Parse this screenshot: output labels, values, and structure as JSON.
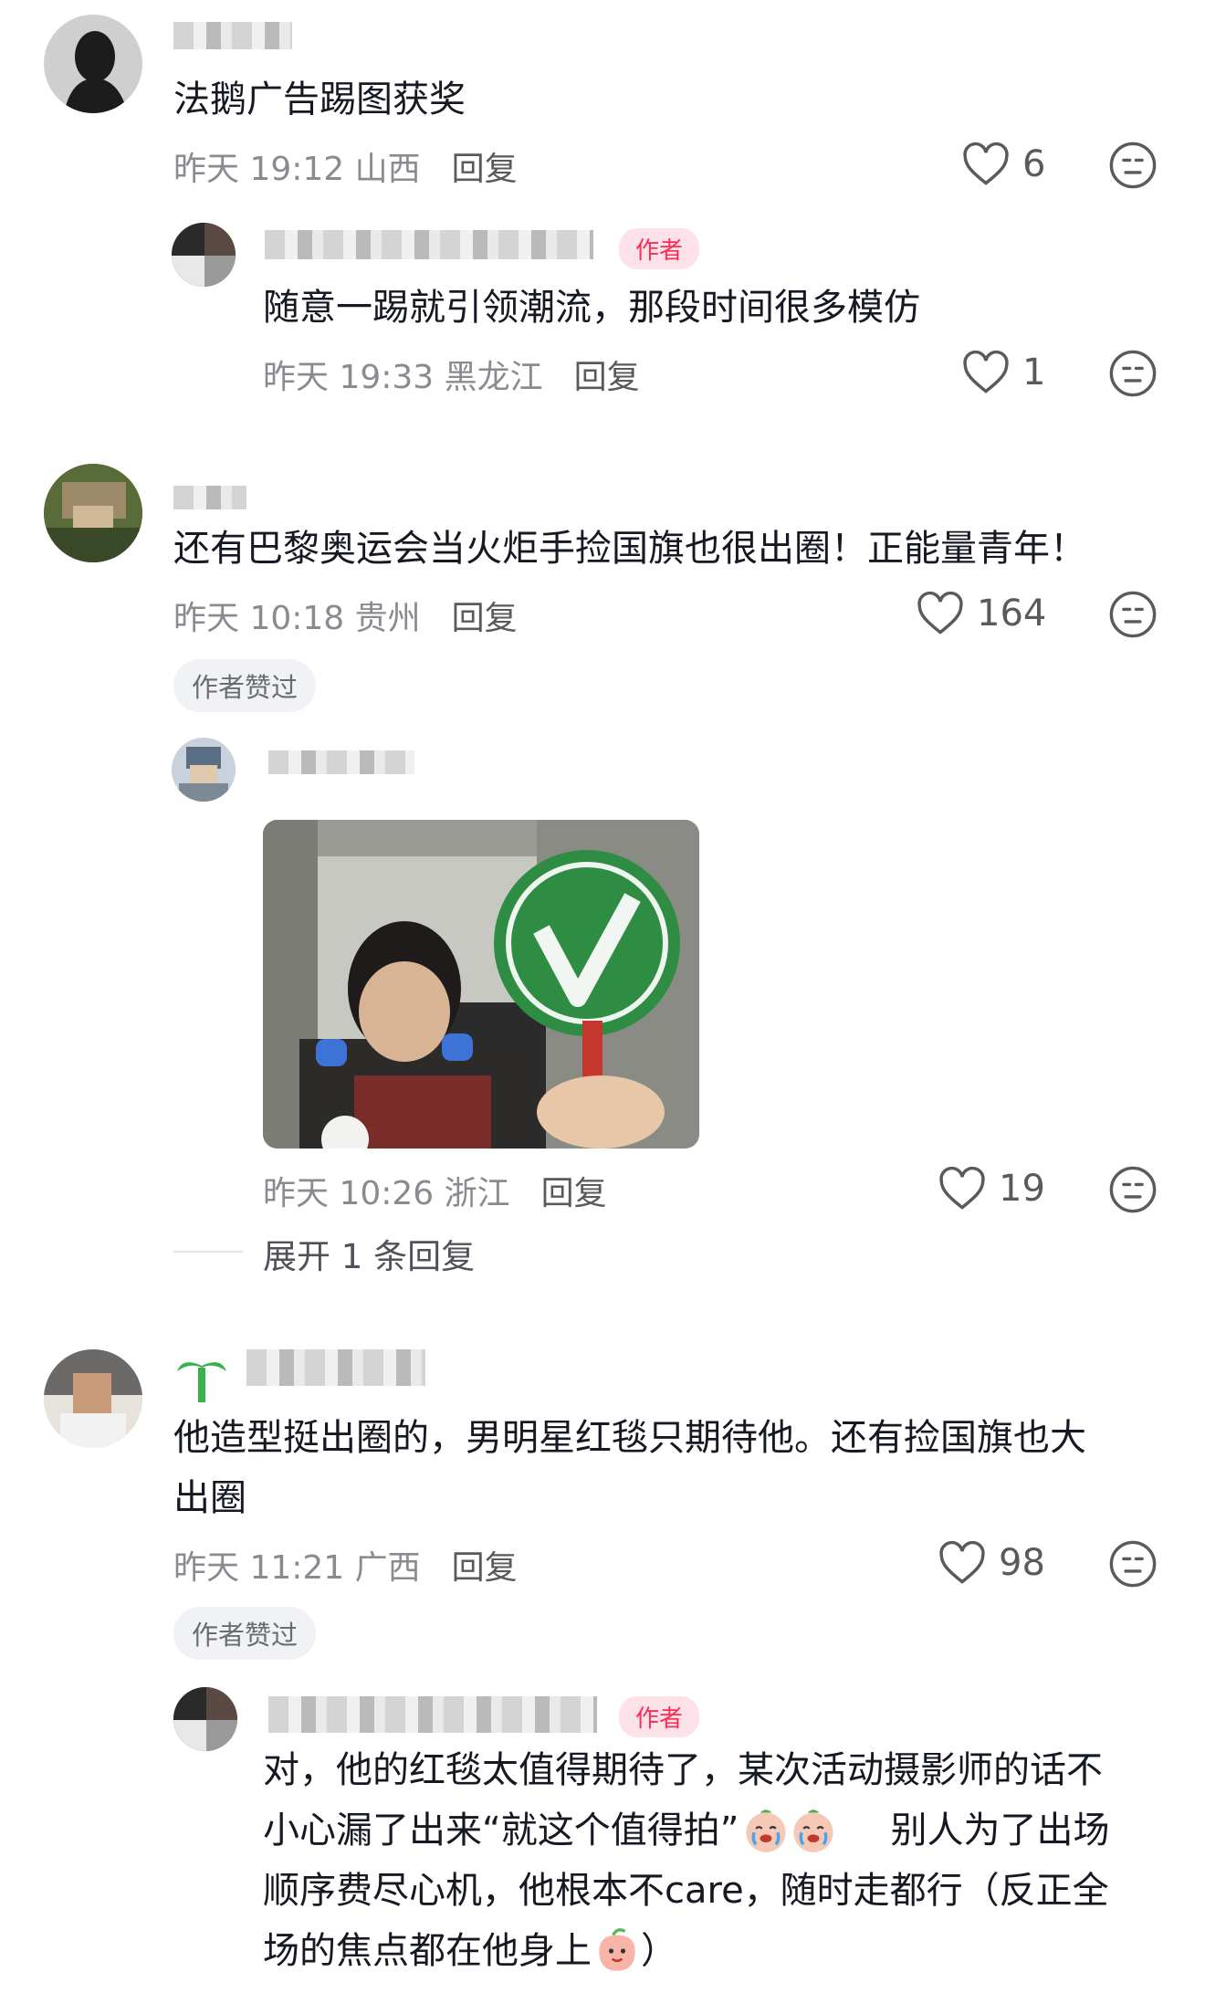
{
  "comments": [
    {
      "text": "法鹅广告踢图获奖",
      "time": "昨天 19:12 山西",
      "reply": "回复",
      "likes": "6",
      "replies": [
        {
          "tag": "作者",
          "text": "随意一踢就引领潮流，那段时间很多模仿",
          "time": "昨天 19:33 黑龙江",
          "reply": "回复",
          "likes": "1"
        }
      ]
    },
    {
      "text": "还有巴黎奥运会当火炬手捡国旗也很出圈！正能量青年！",
      "time": "昨天 10:18 贵州",
      "reply": "回复",
      "likes": "164",
      "badge": "作者赞过",
      "replies": [
        {
          "time": "昨天 10:26 浙江",
          "reply": "回复",
          "likes": "19",
          "expand": "展开 1 条回复"
        }
      ]
    },
    {
      "text_line1": "他造型挺出圈的，男明星红毯只期待他。还有捡国旗也大",
      "text_line2": "出圈",
      "time": "昨天 11:21 广西",
      "reply": "回复",
      "likes": "98",
      "badge": "作者赞过",
      "replies": [
        {
          "tag": "作者",
          "line1": "对，他的红毯太值得期待了，某次活动摄影师的话不",
          "line2a": "小心漏了出来“就这个值得拍”",
          "line2b": "别人为了出场",
          "line3": "顺序费尽心机，他根本不care，随时走都行（反正全",
          "line4a": "场的焦点都在他身上",
          "line4b": "）"
        }
      ]
    }
  ],
  "icons": {
    "like": "heart-outline-icon",
    "dislike": "neutral-face-icon",
    "cry_emoji": "crying-face-emoji",
    "peach_emoji": "peach-face-emoji"
  },
  "colors": {
    "author_tag_bg": "#fde3e9",
    "author_tag_text": "#fe2c55",
    "meta_text": "#8a8b91",
    "badge_bg": "#f1f2f5"
  }
}
